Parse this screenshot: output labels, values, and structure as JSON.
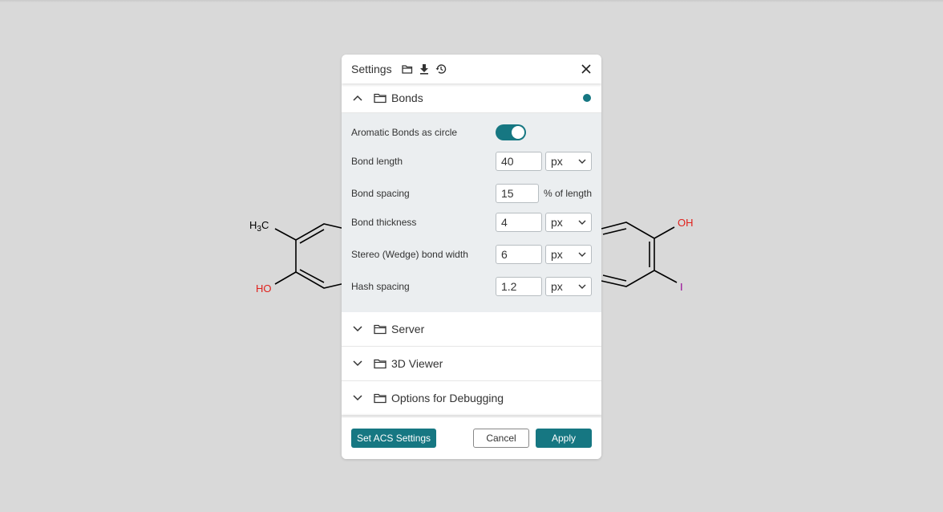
{
  "canvas": {
    "left_molecule": {
      "methyl_h": "H",
      "methyl_sub": "3",
      "methyl_c": "C",
      "hydroxyl": "HO"
    },
    "right_molecule": {
      "hydroxyl": "OH",
      "iodine": "I"
    }
  },
  "dialog": {
    "title": "Settings",
    "header_icons": [
      "folder-open-icon",
      "download-icon",
      "history-icon"
    ],
    "sections": {
      "bonds": {
        "label": "Bonds",
        "expanded": true,
        "modified": true,
        "settings": {
          "aromatic_label": "Aromatic Bonds as circle",
          "aromatic_value": true,
          "length_label": "Bond length",
          "length_value": "40",
          "length_unit": "px",
          "spacing_label": "Bond spacing",
          "spacing_value": "15",
          "spacing_suffix": "% of length",
          "thickness_label": "Bond thickness",
          "thickness_value": "4",
          "thickness_unit": "px",
          "stereo_label": "Stereo (Wedge) bond width",
          "stereo_value": "6",
          "stereo_unit": "px",
          "hash_label": "Hash spacing",
          "hash_value": "1.2",
          "hash_unit": "px"
        }
      },
      "server": {
        "label": "Server",
        "expanded": false
      },
      "viewer3d": {
        "label": "3D Viewer",
        "expanded": false
      },
      "debugging": {
        "label": "Options for Debugging",
        "expanded": false
      }
    },
    "footer": {
      "acs_label": "Set ACS Settings",
      "cancel_label": "Cancel",
      "apply_label": "Apply"
    }
  },
  "colors": {
    "accent": "#167782",
    "background": "#d9d9d9",
    "oxygen": "#e0201b",
    "iodine": "#940094"
  }
}
